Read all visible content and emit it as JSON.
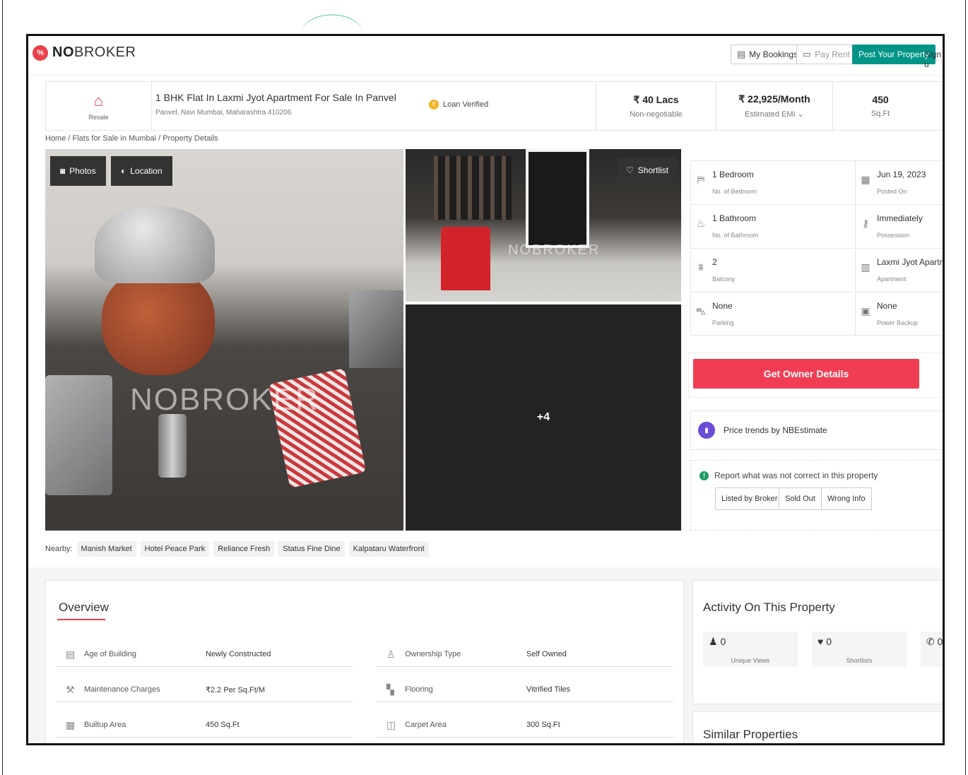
{
  "header": {
    "logo": {
      "bold": "NO",
      "rest": "BROKER"
    },
    "my_bookings": "My Bookings",
    "pay_rent": "Pay Rent",
    "post_property": "Post Your Property",
    "sign_up": "Sign u"
  },
  "listing": {
    "badge": "Resale",
    "title": "1 BHK Flat In Laxmi Jyot Apartment For Sale In Panvel",
    "address": "Panvel, Navi Mumbai, Maharashtra 410206",
    "loan": "Loan Verified",
    "price": "₹ 40 Lacs",
    "price_note": "Non-negotiable",
    "emi": "₹ 22,925/Month",
    "emi_note": "Estimated EMI ⌄",
    "area": "450",
    "area_unit": "Sq.Ft"
  },
  "breadcrumb": "Home / Flats for Sale in Mumbai / Property Details",
  "gallery": {
    "photos_label": "Photos",
    "location_label": "Location",
    "shortlist_label": "Shortlist",
    "more_count": "+4",
    "watermark": "NOBROKER"
  },
  "details": [
    {
      "value": "1 Bedroom",
      "label": "No. of Bedroom",
      "icon": "bed-icon"
    },
    {
      "value": "Jun 19, 2023",
      "label": "Posted On",
      "icon": "calendar-icon"
    },
    {
      "value": "1 Bathroom",
      "label": "No. of Bathroom",
      "icon": "bathtub-icon"
    },
    {
      "value": "Immediately",
      "label": "Possession",
      "icon": "key-icon"
    },
    {
      "value": "2",
      "label": "Balcony",
      "icon": "balcony-icon"
    },
    {
      "value": "Laxmi Jyot Apartm...",
      "label": "Apartment",
      "icon": "building-icon"
    },
    {
      "value": "None",
      "label": "Parking",
      "icon": "car-icon"
    },
    {
      "value": "None",
      "label": "Power Backup",
      "icon": "battery-icon"
    }
  ],
  "owner_button": "Get Owner Details",
  "price_trends": "Price trends by NBEstimate",
  "report": {
    "question": "Report what was not correct in this property",
    "options": [
      "Listed by Broker",
      "Sold Out",
      "Wrong Info"
    ]
  },
  "nearby": {
    "label": "Nearby:",
    "places": [
      "Manish Market",
      "Hotel Peace Park",
      "Reliance Fresh",
      "Status Fine Dine",
      "Kalpataru Waterfront"
    ]
  },
  "overview": {
    "title": "Overview",
    "rows": [
      {
        "key": "Age of Building",
        "value": "Newly Constructed",
        "icon": "building-age-icon"
      },
      {
        "key": "Ownership Type",
        "value": "Self Owned",
        "icon": "ownership-icon"
      },
      {
        "key": "Maintenance Charges",
        "value": "₹2.2 Per Sq.Ft/M",
        "icon": "maintenance-icon"
      },
      {
        "key": "Flooring",
        "value": "Vitrified Tiles",
        "icon": "flooring-icon"
      },
      {
        "key": "Builtup Area",
        "value": "450 Sq.Ft",
        "icon": "builtup-icon"
      },
      {
        "key": "Carpet Area",
        "value": "300 Sq.Ft",
        "icon": "carpet-icon"
      }
    ]
  },
  "activity": {
    "title": "Activity On This Property",
    "stats": [
      {
        "count": "0",
        "label": "Unique Views",
        "icon": "user-icon"
      },
      {
        "count": "0",
        "label": "Shortlists",
        "icon": "heart-icon"
      },
      {
        "count": "0",
        "label": "",
        "icon": "phone-icon"
      }
    ]
  },
  "similar_title": "Similar Properties",
  "colors": {
    "brand_red": "#f13d53",
    "teal": "#009587"
  }
}
